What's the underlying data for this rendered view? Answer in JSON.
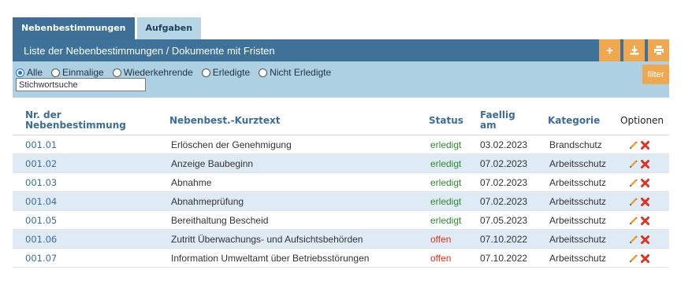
{
  "tabs": [
    {
      "label": "Nebenbestimmungen",
      "active": true
    },
    {
      "label": "Aufgaben",
      "active": false
    }
  ],
  "header": {
    "title": "Liste der Nebenbestimmungen / Dokumente mit Fristen",
    "buttons": {
      "add_label": "+",
      "download_icon": "download-icon",
      "print_icon": "print-icon"
    }
  },
  "filter": {
    "options": [
      {
        "label": "Alle",
        "checked": true
      },
      {
        "label": "Einmalige",
        "checked": false
      },
      {
        "label": "Wiederkehrende",
        "checked": false
      },
      {
        "label": "Erledigte",
        "checked": false
      },
      {
        "label": "Nicht Erledigte",
        "checked": false
      }
    ],
    "search_placeholder": "Stichwortsuche",
    "filter_label": "filter"
  },
  "table": {
    "columns": {
      "nr": "Nr. der Nebenbestimmung",
      "text": "Nebenbest.-Kurztext",
      "status": "Status",
      "faellig": "Faellig am",
      "kategorie": "Kategorie",
      "optionen": "Optionen"
    },
    "rows": [
      {
        "nr": "001.01",
        "text": "Erlöschen der Genehmigung",
        "status": "erledigt",
        "date": "03.02.2023",
        "kategorie": "Brandschutz"
      },
      {
        "nr": "001.02",
        "text": "Anzeige Baubeginn",
        "status": "erledigt",
        "date": "07.02.2023",
        "kategorie": "Arbeitsschutz"
      },
      {
        "nr": "001.03",
        "text": "Abnahme",
        "status": "erledigt",
        "date": "07.02.2023",
        "kategorie": "Arbeitsschutz"
      },
      {
        "nr": "001.04",
        "text": "Abnahmeprüfung",
        "status": "erledigt",
        "date": "07.02.2023",
        "kategorie": "Arbeitsschutz"
      },
      {
        "nr": "001.05",
        "text": "Bereithaltung Bescheid",
        "status": "erledigt",
        "date": "07.05.2023",
        "kategorie": "Arbeitsschutz"
      },
      {
        "nr": "001.06",
        "text": "Zutritt Überwachungs- und Aufsichtsbehörden",
        "status": "offen",
        "date": "07.10.2022",
        "kategorie": "Arbeitsschutz"
      },
      {
        "nr": "001.07",
        "text": "Information Umweltamt über Betriebsstörungen",
        "status": "offen",
        "date": "07.10.2022",
        "kategorie": "Arbeitsschutz"
      }
    ],
    "row_icons": {
      "edit": "pencil-icon",
      "delete": "delete-x-icon"
    }
  },
  "colors": {
    "accent_orange": "#f0a850",
    "header_blue": "#3e7299",
    "filter_blue": "#add0e3",
    "status_done": "#2e8b2e",
    "status_open": "#e0301e"
  }
}
